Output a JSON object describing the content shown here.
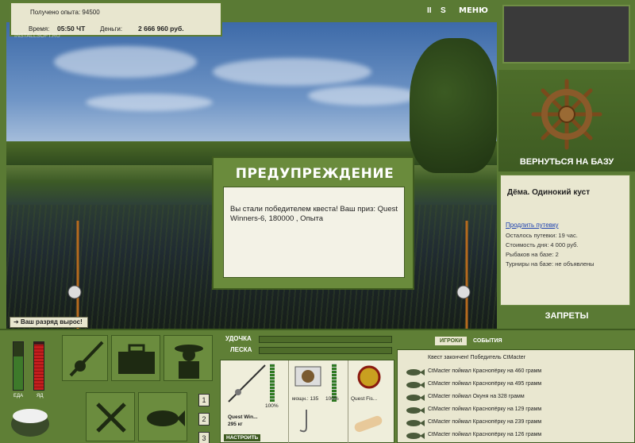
{
  "hud": {
    "experience_label": "Получено опыта:",
    "experience_value": "94500",
    "time_label": "Время:",
    "time_value": "05:50 ЧТ",
    "money_label": "Деньги:",
    "money_value": "2 666 960 руб.",
    "watermark": "INSTALLSOFT.RU"
  },
  "top_controls": {
    "pause": "II",
    "sound": "S",
    "menu": "МЕНЮ"
  },
  "right_panel": {
    "return_button": "ВЕРНУТЬСЯ НА БАЗУ",
    "location_name": "Дёма. Одинокий куст",
    "extend_link": "Продлить путевку",
    "lines": [
      "Осталось путевки: 19 час.",
      "Стоимость дня: 4 000 руб.",
      "Рыбаков на базе: 2",
      "Турниры на базе: не объявлены"
    ],
    "bans_button": "ЗАПРЕТЫ"
  },
  "dialog": {
    "title": "ПРЕДУПРЕЖДЕНИЕ",
    "message": "Вы стали победителем квеста! Ваш приз: Quest Winners-6, 180000 , Опыта"
  },
  "rank_notice": "Ваш разряд вырос!",
  "bottom": {
    "meter_food_label": "ЕДА",
    "meter_food_level": 0.7,
    "meter_shot_label": "ЯД",
    "meter_shot_level": 0.95,
    "num_buttons": [
      "1",
      "2",
      "3"
    ],
    "rod_label": "УДОЧКА",
    "line_label": "ЛЕСКА",
    "tackle": {
      "rod_name": "Quest Win...",
      "rod_weight": "295 кг",
      "rod_percent": "100%",
      "reel_label": "мощн.: 135",
      "reel_percent": "100%",
      "line_name": "Quest Fis...",
      "setup_button": "НАСТРОИТЬ"
    }
  },
  "events": {
    "tabs": [
      "ИГРОКИ",
      "СОБЫТИЯ"
    ],
    "header": "Квест закончен! Победитель CtMacter",
    "rows": [
      "CtMacter поймал Краснопёрку на 460 грамм",
      "CtMacter поймал Краснопёрку на 495 грамм",
      "CtMacter поймал Окуня на 328 грамм",
      "CtMacter поймал Краснопёрку на 129 грамм",
      "CtMacter поймал Краснопёрку на 239 грамм",
      "CtMacter поймал Краснопёрку на 126 грамм"
    ]
  },
  "colors": {
    "panel_green": "#5f7f36",
    "parchment": "#e9e7d0",
    "food_meter": "#3d7a2a",
    "shot_meter": "#c41e1e"
  }
}
